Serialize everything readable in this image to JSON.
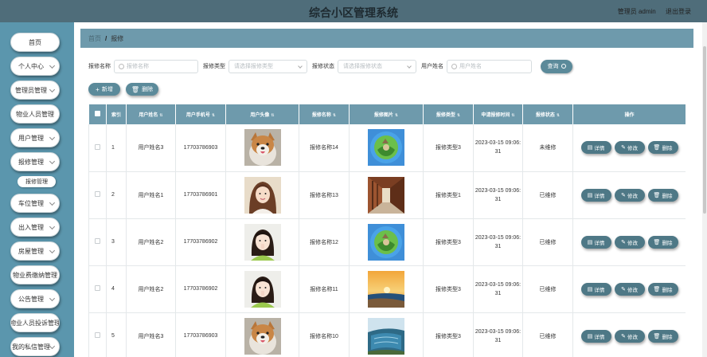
{
  "header": {
    "title": "综合小区管理系统",
    "user_label": "管理员 admin",
    "logout_label": "退出登录"
  },
  "sidebar": {
    "items": [
      {
        "label": "首页",
        "chevron": false
      },
      {
        "label": "个人中心",
        "chevron": true
      },
      {
        "label": "管理员管理",
        "chevron": true
      },
      {
        "label": "物业人员管理",
        "chevron": false
      },
      {
        "label": "用户管理",
        "chevron": true
      },
      {
        "label": "报修管理",
        "chevron": true
      },
      {
        "label": "车位管理",
        "chevron": true
      },
      {
        "label": "出入管理",
        "chevron": true
      },
      {
        "label": "房屋管理",
        "chevron": true
      },
      {
        "label": "物业费缴纳管理",
        "chevron": false
      },
      {
        "label": "公告管理",
        "chevron": true
      },
      {
        "label": "物业人员投诉管理",
        "chevron": false
      },
      {
        "label": "我的私信管理",
        "chevron": true
      }
    ],
    "sub_item": "报修管理"
  },
  "breadcrumb": {
    "home": "首页",
    "separator": "/",
    "current": "报修"
  },
  "search": {
    "name_label": "报修名称",
    "name_placeholder": "报修名称",
    "type_label": "报修类型",
    "type_placeholder": "请选择报修类型",
    "status_label": "报修状态",
    "status_placeholder": "请选择报修状态",
    "user_label": "用户姓名",
    "user_placeholder": "用户姓名",
    "query_label": "查询"
  },
  "actions": {
    "add_label": "新增",
    "delete_label": "删除"
  },
  "table": {
    "headers": {
      "index": "索引",
      "user_name": "用户姓名",
      "phone": "用户手机号",
      "avatar": "用户头像",
      "repair_name": "报修名称",
      "repair_image": "报修图片",
      "repair_type": "报修类型",
      "apply_time": "申请报修时间",
      "repair_status": "报修状态",
      "ops": "操作"
    },
    "op_labels": {
      "detail": "详情",
      "edit": "修改",
      "delete": "删除"
    },
    "rows": [
      {
        "index": "1",
        "user_name": "用户姓名3",
        "phone": "17703786903",
        "avatar": "dog",
        "repair_name": "报修名称14",
        "image": "globe",
        "repair_type": "报修类型3",
        "apply_time": "2023-03-15 09:06:31",
        "status": "未维修"
      },
      {
        "index": "2",
        "user_name": "用户姓名1",
        "phone": "17703786901",
        "avatar": "girl-a",
        "repair_name": "报修名称13",
        "image": "corridor",
        "repair_type": "报修类型1",
        "apply_time": "2023-03-15 09:06:31",
        "status": "已维修"
      },
      {
        "index": "3",
        "user_name": "用户姓名2",
        "phone": "17703786902",
        "avatar": "girl-b",
        "repair_name": "报修名称12",
        "image": "globe",
        "repair_type": "报修类型3",
        "apply_time": "2023-03-15 09:06:31",
        "status": "已维修"
      },
      {
        "index": "4",
        "user_name": "用户姓名2",
        "phone": "17703786902",
        "avatar": "girl-b",
        "repair_name": "报修名称11",
        "image": "sunset",
        "repair_type": "报修类型3",
        "apply_time": "2023-03-15 09:06:31",
        "status": "已维修"
      },
      {
        "index": "5",
        "user_name": "用户姓名3",
        "phone": "17703786903",
        "avatar": "dog",
        "repair_name": "报修名称10",
        "image": "river",
        "repair_type": "报修类型3",
        "apply_time": "2023-03-15 09:06:31",
        "status": "已维修"
      }
    ]
  },
  "colors": {
    "topbar": "#4f6d7a",
    "sidebar": "#5b96ad",
    "accent": "#6e9aac",
    "button": "#5b8a9a"
  }
}
